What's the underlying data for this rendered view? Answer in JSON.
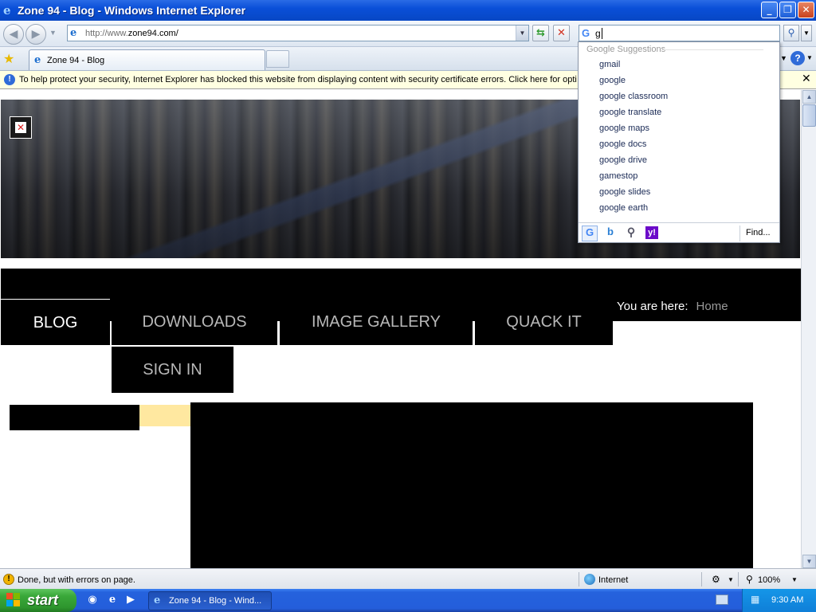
{
  "window": {
    "title": "Zone 94 - Blog - Windows Internet Explorer",
    "minimize": "_",
    "restore": "❐",
    "close": "✕"
  },
  "address": {
    "protocol": "http://www.",
    "domain": "zone94.com/"
  },
  "search": {
    "query": "g",
    "provider_icon": "G",
    "suggestions_header": "Google Suggestions",
    "suggestions": [
      {
        "match": "g",
        "rest": "mail"
      },
      {
        "match": "g",
        "rest": "oogle"
      },
      {
        "match": "g",
        "rest": "oogle classroom"
      },
      {
        "match": "g",
        "rest": "oogle translate"
      },
      {
        "match": "g",
        "rest": "oogle maps"
      },
      {
        "match": "g",
        "rest": "oogle docs"
      },
      {
        "match": "g",
        "rest": "oogle drive"
      },
      {
        "match": "g",
        "rest": "amestop"
      },
      {
        "match": "g",
        "rest": "oogle slides"
      },
      {
        "match": "g",
        "rest": "oogle earth"
      }
    ],
    "find_label": "Find...",
    "providers": {
      "google": "G",
      "bing": "b",
      "yahoo": "y!"
    }
  },
  "tabs": [
    {
      "label": "Zone 94 - Blog"
    }
  ],
  "infobar": {
    "message": "To help protect your security, Internet Explorer has blocked this website from displaying content with security certificate errors. Click here for opti"
  },
  "page": {
    "nav": [
      {
        "label": "BLOG",
        "active": true
      },
      {
        "label": "DOWNLOADS",
        "active": false
      },
      {
        "label": "IMAGE GALLERY",
        "active": false
      },
      {
        "label": "QUACK IT",
        "active": false
      },
      {
        "label": "SIGN IN",
        "active": false
      }
    ],
    "breadcrumb_label": "You are here:",
    "breadcrumb_home": "Home"
  },
  "statusbar": {
    "text": "Done, but with errors on page.",
    "zone": "Internet",
    "zoom": "100%"
  },
  "taskbar": {
    "start_label": "start",
    "task_label": "Zone 94 - Blog - Wind...",
    "clock": "9:30 AM"
  },
  "colors": {
    "titlebar": "#0a4fd8",
    "infobar": "#ffffe1",
    "nav_background": "#000000",
    "nav_text": "#b8b8b8",
    "nav_active_text": "#ffffff",
    "yellow_block": "#ffe8a0",
    "start_green": "#3aa83a"
  }
}
